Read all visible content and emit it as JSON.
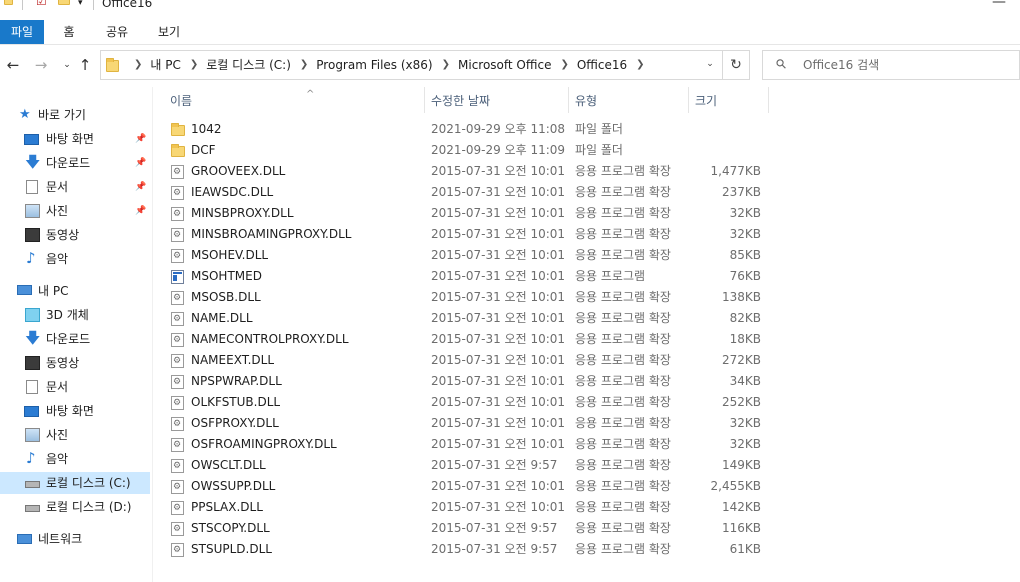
{
  "window": {
    "title": "Office16"
  },
  "ribbon": {
    "tabs": [
      "파일",
      "홈",
      "공유",
      "보기"
    ]
  },
  "address": {
    "crumbs": [
      "내 PC",
      "로컬 디스크 (C:)",
      "Program Files (x86)",
      "Microsoft Office",
      "Office16"
    ]
  },
  "search": {
    "placeholder": "Office16 검색"
  },
  "sidebar": {
    "items": [
      {
        "label": "바로 가기",
        "icon": "star-icon",
        "pinned": false
      },
      {
        "label": "바탕 화면",
        "icon": "desktop-icon",
        "pinned": true
      },
      {
        "label": "다운로드",
        "icon": "download-icon",
        "pinned": true
      },
      {
        "label": "문서",
        "icon": "document-icon",
        "pinned": true
      },
      {
        "label": "사진",
        "icon": "picture-icon",
        "pinned": true
      },
      {
        "label": "동영상",
        "icon": "video-icon",
        "pinned": false
      },
      {
        "label": "음악",
        "icon": "music-icon",
        "pinned": false
      },
      {
        "label": "내 PC",
        "icon": "pc-icon",
        "pinned": false
      },
      {
        "label": "3D 개체",
        "icon": "cube-icon",
        "pinned": false
      },
      {
        "label": "다운로드",
        "icon": "download-icon",
        "pinned": false
      },
      {
        "label": "동영상",
        "icon": "video-icon",
        "pinned": false
      },
      {
        "label": "문서",
        "icon": "document-icon",
        "pinned": false
      },
      {
        "label": "바탕 화면",
        "icon": "desktop-icon",
        "pinned": false
      },
      {
        "label": "사진",
        "icon": "picture-icon",
        "pinned": false
      },
      {
        "label": "음악",
        "icon": "music-icon",
        "pinned": false
      },
      {
        "label": "로컬 디스크 (C:)",
        "icon": "drive-icon",
        "pinned": false,
        "selected": true
      },
      {
        "label": "로컬 디스크 (D:)",
        "icon": "drive-icon",
        "pinned": false
      },
      {
        "label": "네트워크",
        "icon": "network-icon",
        "pinned": false
      }
    ]
  },
  "columns": {
    "name": "이름",
    "date": "수정한 날짜",
    "type": "유형",
    "size": "크기"
  },
  "files": [
    {
      "name": "1042",
      "date": "2021-09-29 오후 11:08",
      "type": "파일 폴더",
      "size": "",
      "kind": "folder"
    },
    {
      "name": "DCF",
      "date": "2021-09-29 오후 11:09",
      "type": "파일 폴더",
      "size": "",
      "kind": "folder"
    },
    {
      "name": "GROOVEEX.DLL",
      "date": "2015-07-31 오전 10:01",
      "type": "응용 프로그램 확장",
      "size": "1,477KB",
      "kind": "dll"
    },
    {
      "name": "IEAWSDC.DLL",
      "date": "2015-07-31 오전 10:01",
      "type": "응용 프로그램 확장",
      "size": "237KB",
      "kind": "dll"
    },
    {
      "name": "MINSBPROXY.DLL",
      "date": "2015-07-31 오전 10:01",
      "type": "응용 프로그램 확장",
      "size": "32KB",
      "kind": "dll"
    },
    {
      "name": "MINSBROAMINGPROXY.DLL",
      "date": "2015-07-31 오전 10:01",
      "type": "응용 프로그램 확장",
      "size": "32KB",
      "kind": "dll"
    },
    {
      "name": "MSOHEV.DLL",
      "date": "2015-07-31 오전 10:01",
      "type": "응용 프로그램 확장",
      "size": "85KB",
      "kind": "dll"
    },
    {
      "name": "MSOHTMED",
      "date": "2015-07-31 오전 10:01",
      "type": "응용 프로그램",
      "size": "76KB",
      "kind": "exe"
    },
    {
      "name": "MSOSB.DLL",
      "date": "2015-07-31 오전 10:01",
      "type": "응용 프로그램 확장",
      "size": "138KB",
      "kind": "dll"
    },
    {
      "name": "NAME.DLL",
      "date": "2015-07-31 오전 10:01",
      "type": "응용 프로그램 확장",
      "size": "82KB",
      "kind": "dll"
    },
    {
      "name": "NAMECONTROLPROXY.DLL",
      "date": "2015-07-31 오전 10:01",
      "type": "응용 프로그램 확장",
      "size": "18KB",
      "kind": "dll"
    },
    {
      "name": "NAMEEXT.DLL",
      "date": "2015-07-31 오전 10:01",
      "type": "응용 프로그램 확장",
      "size": "272KB",
      "kind": "dll"
    },
    {
      "name": "NPSPWRAP.DLL",
      "date": "2015-07-31 오전 10:01",
      "type": "응용 프로그램 확장",
      "size": "34KB",
      "kind": "dll"
    },
    {
      "name": "OLKFSTUB.DLL",
      "date": "2015-07-31 오전 10:01",
      "type": "응용 프로그램 확장",
      "size": "252KB",
      "kind": "dll"
    },
    {
      "name": "OSFPROXY.DLL",
      "date": "2015-07-31 오전 10:01",
      "type": "응용 프로그램 확장",
      "size": "32KB",
      "kind": "dll"
    },
    {
      "name": "OSFROAMINGPROXY.DLL",
      "date": "2015-07-31 오전 10:01",
      "type": "응용 프로그램 확장",
      "size": "32KB",
      "kind": "dll"
    },
    {
      "name": "OWSCLT.DLL",
      "date": "2015-07-31 오전 9:57",
      "type": "응용 프로그램 확장",
      "size": "149KB",
      "kind": "dll"
    },
    {
      "name": "OWSSUPP.DLL",
      "date": "2015-07-31 오전 10:01",
      "type": "응용 프로그램 확장",
      "size": "2,455KB",
      "kind": "dll"
    },
    {
      "name": "PPSLAX.DLL",
      "date": "2015-07-31 오전 10:01",
      "type": "응용 프로그램 확장",
      "size": "142KB",
      "kind": "dll"
    },
    {
      "name": "STSCOPY.DLL",
      "date": "2015-07-31 오전 9:57",
      "type": "응용 프로그램 확장",
      "size": "116KB",
      "kind": "dll"
    },
    {
      "name": "STSUPLD.DLL",
      "date": "2015-07-31 오전 9:57",
      "type": "응용 프로그램 확장",
      "size": "61KB",
      "kind": "dll"
    }
  ],
  "colors": {
    "accent": "#1979ca",
    "selection": "#cce8ff",
    "header_text": "#4c607a"
  }
}
